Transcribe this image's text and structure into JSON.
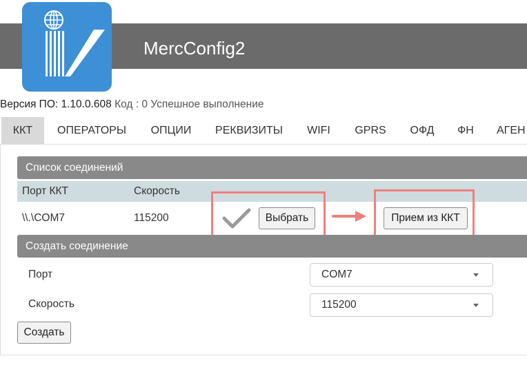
{
  "app": {
    "title": "MercConfig2"
  },
  "status": {
    "version_label": "Версия ПО: 1.10.0.608",
    "code_text": "Код : 0 Успешное выполнение"
  },
  "tabs": [
    {
      "label": "ККТ",
      "active": true
    },
    {
      "label": "ОПЕРАТОРЫ"
    },
    {
      "label": "ОПЦИИ"
    },
    {
      "label": "РЕКВИЗИТЫ"
    },
    {
      "label": "WIFI"
    },
    {
      "label": "GPRS"
    },
    {
      "label": "ОФД"
    },
    {
      "label": "ФН"
    },
    {
      "label": "АГЕН"
    }
  ],
  "connections": {
    "header": "Список соединений",
    "columns": [
      "Порт ККТ",
      "Скорость"
    ],
    "rows": [
      {
        "port": "\\\\.\\COM7",
        "speed": "115200"
      }
    ],
    "select_button": "Выбрать",
    "receive_button": "Прием из ККТ"
  },
  "create": {
    "header": "Создать соединение",
    "port_label": "Порт",
    "port_value": "COM7",
    "speed_label": "Скорость",
    "speed_value": "115200",
    "create_button": "Создать"
  },
  "colors": {
    "header_bar": "#6b6b6b",
    "logo_bg": "#3d8fd6",
    "section_header": "#898989",
    "table_header": "#cfdcdf",
    "highlight": "#ee7f7f",
    "active_tab": "#d9d9d9"
  },
  "icons": {
    "logo": "company-logo-icon",
    "checkmark": "checkmark-icon",
    "arrow": "arrow-right-icon",
    "dropdown": "chevron-down-icon"
  }
}
